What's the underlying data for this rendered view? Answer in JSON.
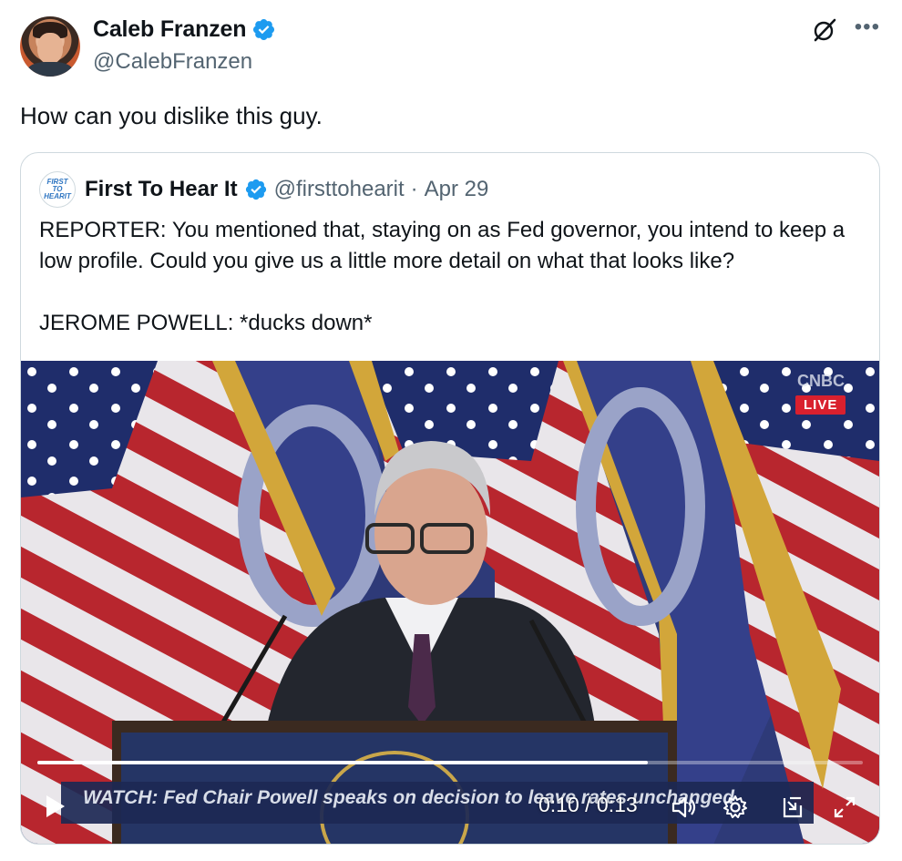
{
  "author": {
    "display_name": "Caleb Franzen",
    "handle": "@CalebFranzen",
    "verified": true
  },
  "tweet": {
    "text": "How can you dislike this guy."
  },
  "quote": {
    "avatar_text": [
      "FIRST",
      "TO",
      "HEARIT"
    ],
    "display_name": "First To Hear It",
    "handle": "@firsttohearit",
    "separator": "·",
    "date": "Apr 29",
    "body": "REPORTER: You mentioned that, staying on as Fed governor, you intend to keep a low profile. Could you give us a little more detail on what that looks like?\n\nJEROME POWELL: *ducks down*"
  },
  "video": {
    "live_badge": "LIVE",
    "network_logo": "CNBC",
    "caption": "WATCH: Fed Chair Powell speaks on decision to leave rates unchanged",
    "current_time": "0:10",
    "duration": "0:13",
    "time_display": "0:10 / 0:13",
    "progress": 0.74,
    "controls": [
      "play-icon",
      "volume-icon",
      "settings-gear-icon",
      "picture-in-picture-icon",
      "fullscreen-icon"
    ]
  },
  "colors": {
    "verified_blue": "#1d9bf0",
    "text_primary": "#0f1419",
    "text_secondary": "#536471",
    "border": "#cfd9de",
    "live_red": "#d9202e"
  }
}
